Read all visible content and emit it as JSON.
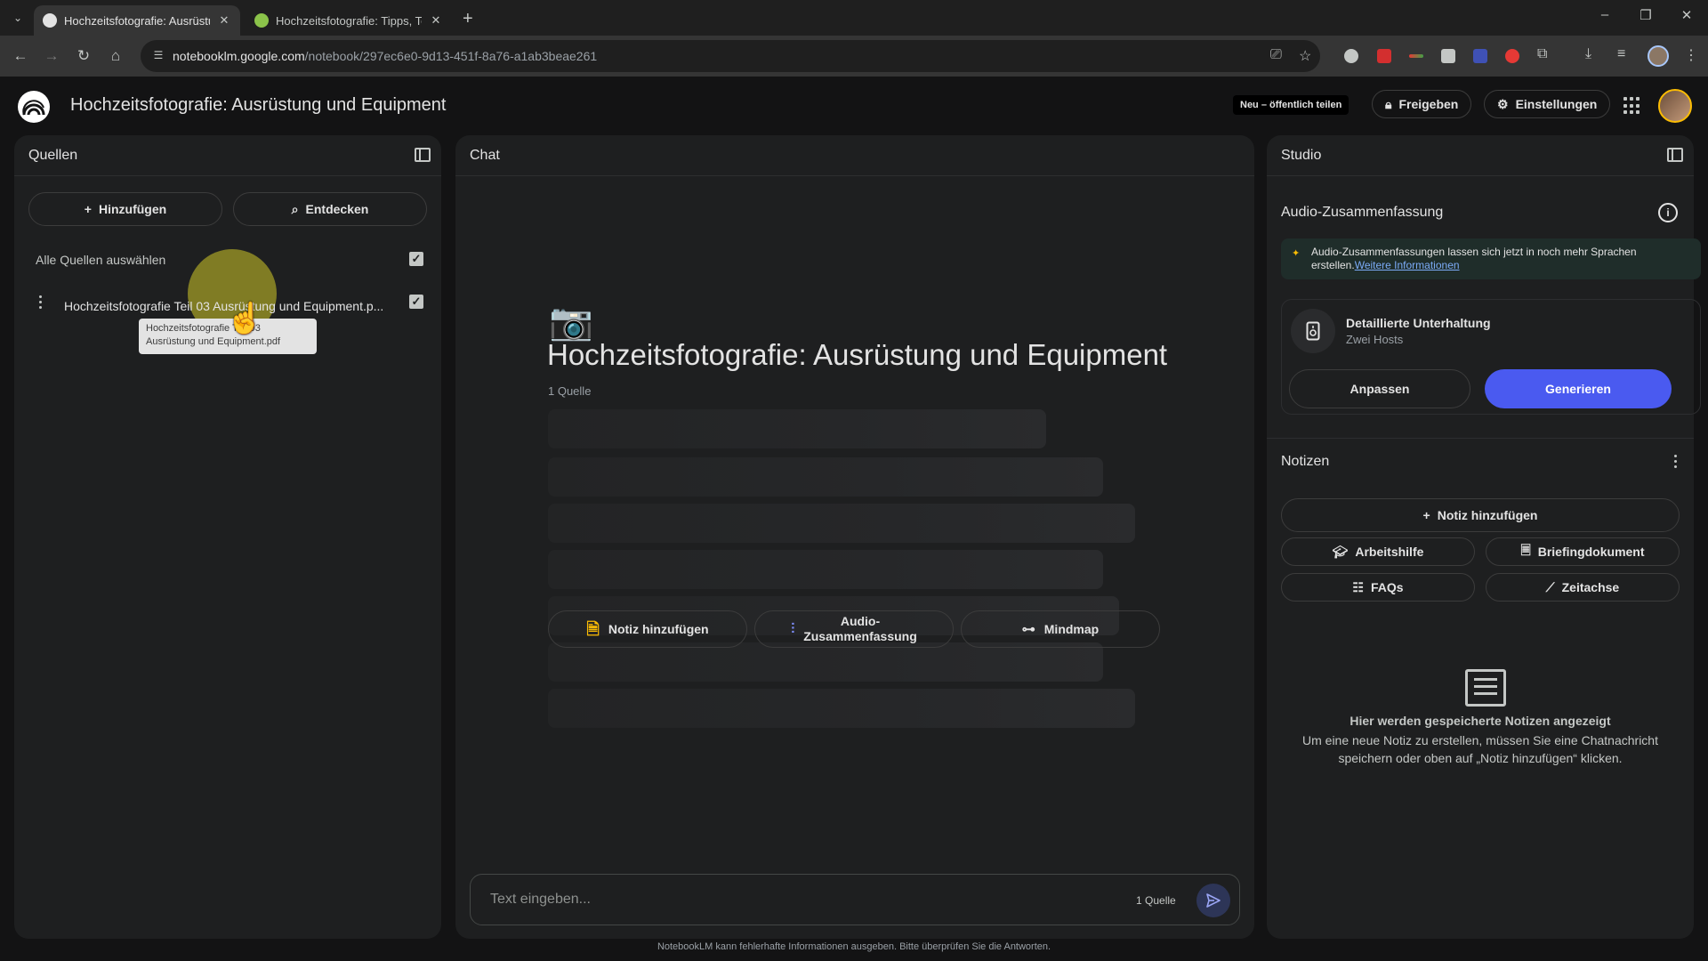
{
  "browser": {
    "tabs": [
      {
        "title": "Hochzeitsfotografie: Ausrüstun",
        "active": true
      },
      {
        "title": "Hochzeitsfotografie: Tipps, Tech",
        "active": false
      }
    ],
    "url_host": "notebooklm.google.com",
    "url_path": "/notebook/297ec6e0-9d13-451f-8a76-a1ab3beae261"
  },
  "header": {
    "title": "Hochzeitsfotografie: Ausrüstung und Equipment",
    "new_badge": "Neu – öffentlich teilen",
    "share_label": "Freigeben",
    "settings_label": "Einstellungen"
  },
  "sources": {
    "title": "Quellen",
    "add_label": "Hinzufügen",
    "discover_label": "Entdecken",
    "select_all_label": "Alle Quellen auswählen",
    "items": [
      {
        "label": "Hochzeitsfotografie Teil 03 Ausrüstung und Equipment.p...",
        "checked": true
      }
    ],
    "tooltip_line1": "Hochzeitsfotografie Teil 03",
    "tooltip_line2": "Ausrüstung und Equipment.pdf"
  },
  "chat": {
    "title": "Chat",
    "emoji": "📷",
    "notebook_title": "Hochzeitsfotografie: Ausrüstung und Equipment",
    "source_count": "1 Quelle",
    "actions": {
      "add_note": "Notiz hinzufügen",
      "audio_line1": "Audio-",
      "audio_line2": "Zusammenfassung",
      "mindmap": "Mindmap"
    },
    "input_placeholder": "Text eingeben...",
    "input_source_count": "1 Quelle",
    "footer": "NotebookLM kann fehlerhafte Informationen ausgeben. Bitte überprüfen Sie die Antworten."
  },
  "studio": {
    "title": "Studio",
    "audio_section_title": "Audio-Zusammenfassung",
    "info_text": "Audio-Zusammenfassungen lassen sich jetzt in noch mehr Sprachen erstellen.",
    "info_link": "Weitere Informationen",
    "card_title": "Detaillierte Unterhaltung",
    "card_sub": "Zwei Hosts",
    "customize_label": "Anpassen",
    "generate_label": "Generieren",
    "notes_title": "Notizen",
    "add_note_label": "Notiz hinzufügen",
    "note_buttons": [
      "Arbeitshilfe",
      "Briefingdokument",
      "FAQs",
      "Zeitachse"
    ],
    "empty_title": "Hier werden gespeicherte Notizen angezeigt",
    "empty_desc": "Um eine neue Notiz zu erstellen, müssen Sie eine Chatnachricht speichern oder oben auf „Notiz hinzufügen“ klicken."
  },
  "colors": {
    "primary_button": "#4a5af0",
    "background": "#131314",
    "panel": "#1e1f20"
  }
}
